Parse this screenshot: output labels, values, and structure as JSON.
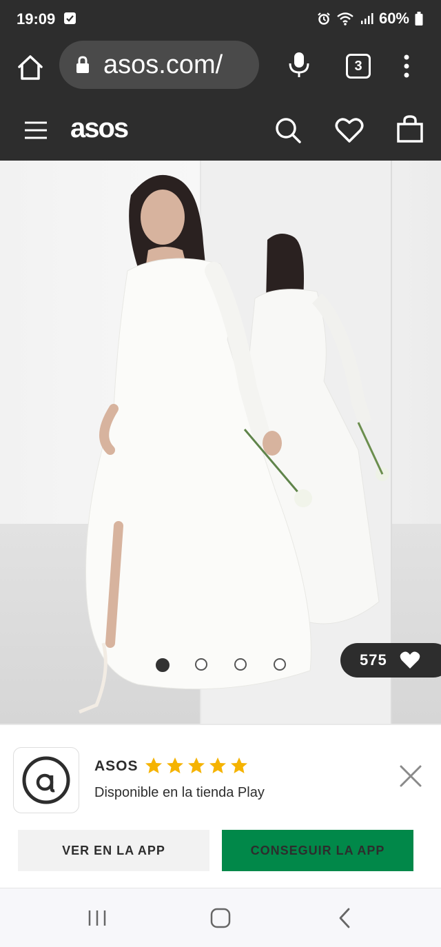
{
  "status_bar": {
    "time": "19:09",
    "battery": "60%"
  },
  "browser": {
    "url": "asos.com/",
    "tab_count": "3"
  },
  "site_header": {
    "logo": "asos"
  },
  "product": {
    "likes": "575",
    "image_dots": 4,
    "active_dot": 0
  },
  "app_banner": {
    "name": "ASOS",
    "rating": 5,
    "subtitle": "Disponible en la tienda Play",
    "view_button": "VER EN LA APP",
    "get_button": "CONSEGUIR LA APP",
    "accent_color": "#018849"
  }
}
